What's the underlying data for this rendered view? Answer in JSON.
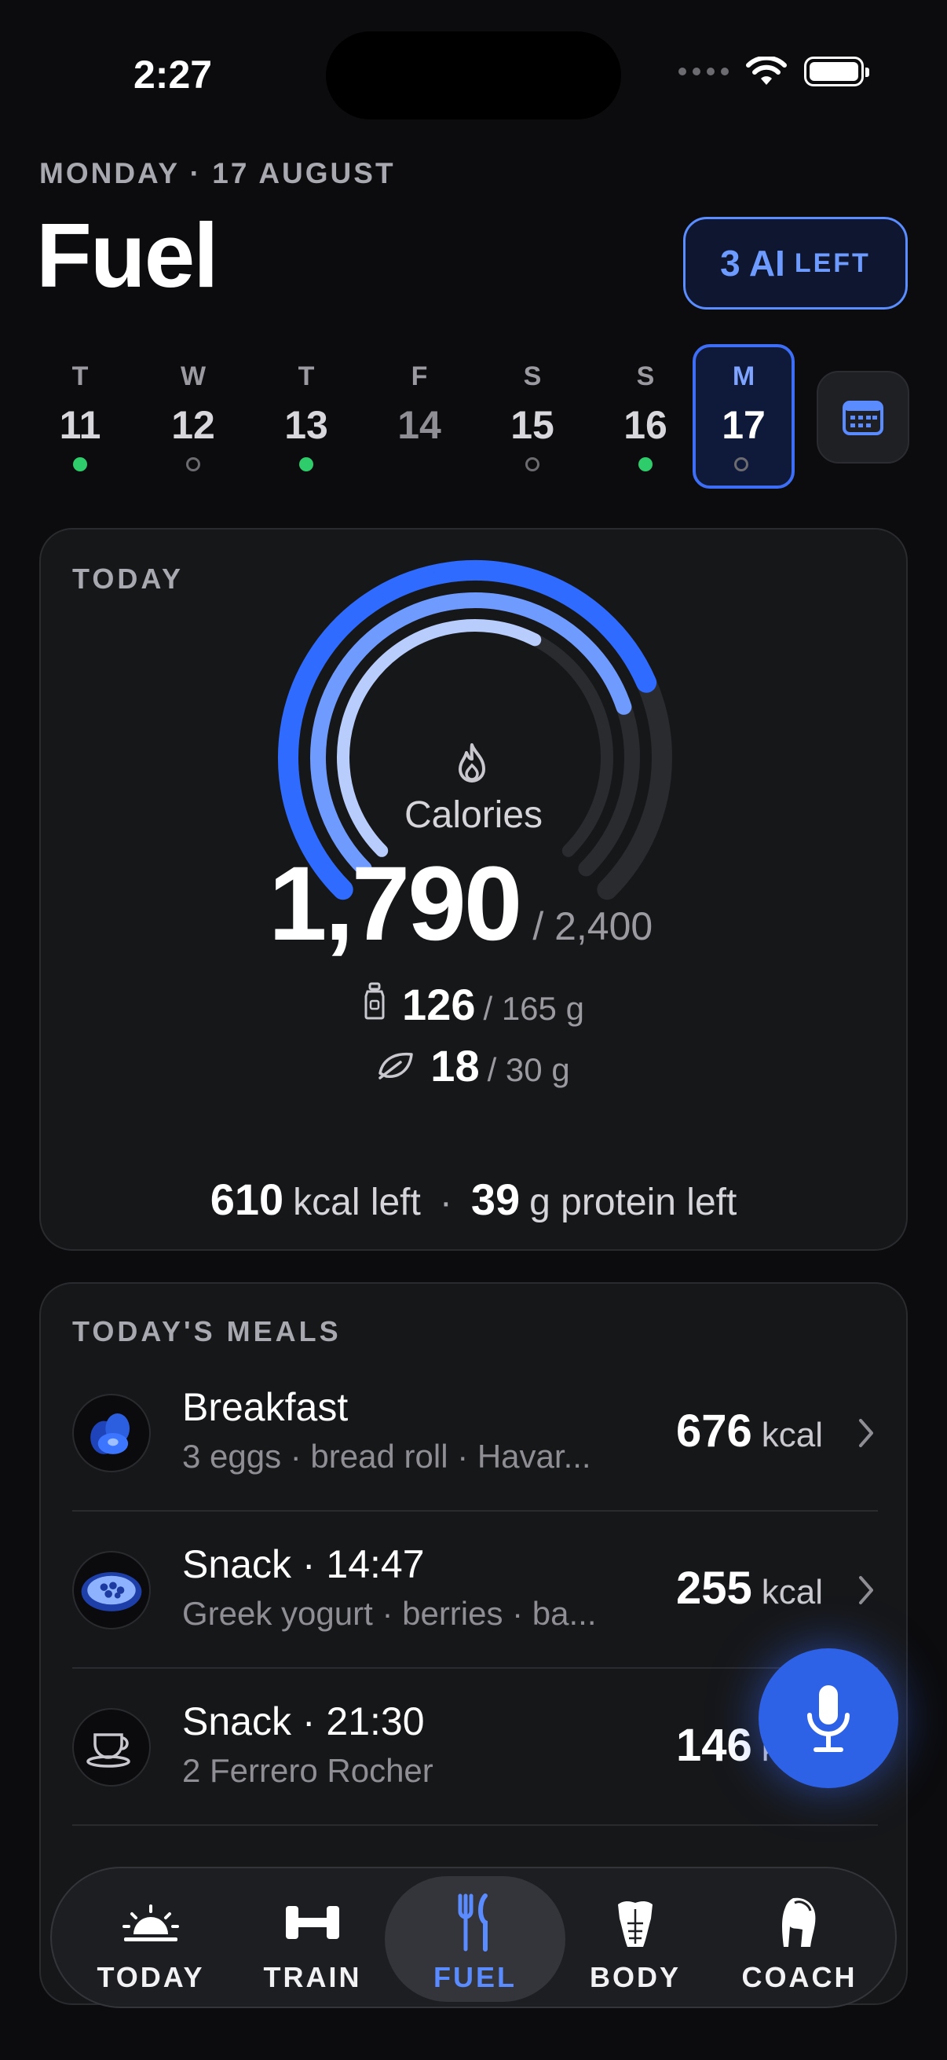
{
  "status": {
    "time": "2:27"
  },
  "header": {
    "date": "MONDAY · 17 AUGUST",
    "title": "Fuel",
    "ai_count": "3 AI",
    "ai_suffix": "LEFT"
  },
  "week": [
    {
      "letter": "T",
      "num": "11",
      "status": "done"
    },
    {
      "letter": "W",
      "num": "12",
      "status": "empty"
    },
    {
      "letter": "T",
      "num": "13",
      "status": "done"
    },
    {
      "letter": "F",
      "num": "14",
      "status": "none"
    },
    {
      "letter": "S",
      "num": "15",
      "status": "empty"
    },
    {
      "letter": "S",
      "num": "16",
      "status": "done"
    },
    {
      "letter": "M",
      "num": "17",
      "status": "empty",
      "selected": true
    }
  ],
  "today": {
    "label": "TODAY",
    "calories_label": "Calories",
    "calories": "1,790",
    "calories_goal": "/ 2,400",
    "protein": "126",
    "protein_goal": "/ 165 g",
    "fiber": "18",
    "fiber_goal": "/ 30 g",
    "kcal_left": "610",
    "kcal_left_text": "kcal left",
    "separator": "·",
    "protein_left": "39",
    "protein_left_text": "g protein left",
    "ring_progress": {
      "calories": 0.746,
      "protein": 0.764,
      "fiber": 0.6
    },
    "colors": {
      "calories": "#2f6bff",
      "protein": "#6f9bff",
      "fiber": "#b9cdfd",
      "track": "#2a2b2f"
    }
  },
  "meals": {
    "label": "TODAY'S MEALS",
    "items": [
      {
        "name": "Breakfast",
        "desc": "3 eggs · bread roll · Havar...",
        "kcal": "676",
        "unit": "kcal",
        "icon": "eggs-icon"
      },
      {
        "name": "Snack · 14:47",
        "desc": "Greek yogurt · berries · ba...",
        "kcal": "255",
        "unit": "kcal",
        "icon": "yogurt-bowl-icon"
      },
      {
        "name": "Snack · 21:30",
        "desc": "2 Ferrero Rocher",
        "kcal": "146",
        "unit": "kcal",
        "icon": "cup-icon"
      }
    ]
  },
  "tabs": [
    {
      "label": "TODAY",
      "icon": "sunrise-icon"
    },
    {
      "label": "TRAIN",
      "icon": "dumbbell-icon"
    },
    {
      "label": "FUEL",
      "icon": "fork-knife-icon",
      "active": true
    },
    {
      "label": "BODY",
      "icon": "torso-icon"
    },
    {
      "label": "COACH",
      "icon": "spartan-helmet-icon"
    }
  ]
}
